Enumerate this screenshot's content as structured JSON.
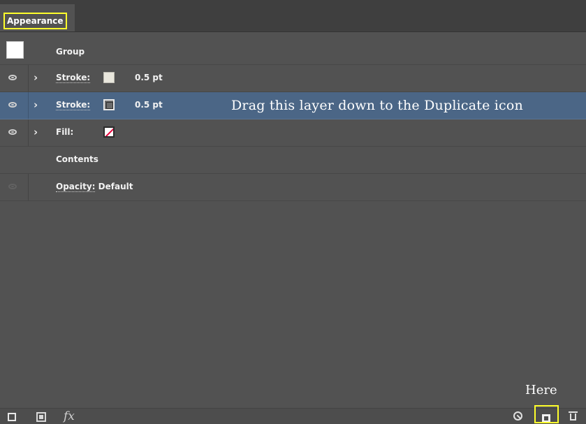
{
  "panel": {
    "tab_title": "Appearance"
  },
  "rows": [
    {
      "label": "Group"
    },
    {
      "label": "Stroke:",
      "value": "0.5 pt"
    },
    {
      "label": "Stroke:",
      "value": "0.5 pt",
      "selected": true
    },
    {
      "label": "Fill:"
    },
    {
      "label": "Contents"
    },
    {
      "label": "Opacity:",
      "value": "Default"
    }
  ],
  "annotations": {
    "drag_hint": "Drag this layer down to the Duplicate icon",
    "here": "Here"
  },
  "bottom_bar": {
    "icons": [
      "new-art-icon",
      "layer-icon",
      "fx-icon",
      "clear-appearance-icon",
      "duplicate-item-icon",
      "trash-icon"
    ],
    "fx_glyph": "fx"
  },
  "colors": {
    "panel_bg": "#525252",
    "tab_bar_bg": "#3f3f3f",
    "selected_row": "#4b6686",
    "highlight": "#ffff2b",
    "fill_none_slash": "#e8003a"
  }
}
